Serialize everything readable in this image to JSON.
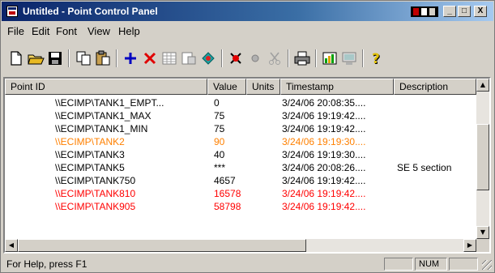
{
  "window": {
    "title": "Untitled - Point Control Panel",
    "controls": {
      "minimize": "_",
      "maximize": "□",
      "close": "X"
    }
  },
  "menu": [
    "File",
    "Edit",
    "Font",
    "View",
    "Help"
  ],
  "toolbar_icons": [
    "new-icon",
    "open-icon",
    "save-icon",
    "copy-icon",
    "paste-icon",
    "add-icon",
    "delete-icon",
    "grid-icon",
    "properties-icon",
    "refresh-icon",
    "stop-icon",
    "circle-icon",
    "cut-icon",
    "print-icon",
    "chart-icon",
    "monitor-icon",
    "help-icon"
  ],
  "table": {
    "headers": [
      "Point ID",
      "Value",
      "Units",
      "Timestamp",
      "Description"
    ],
    "rows": [
      {
        "id": "\\\\ECIMP\\TANK1_EMPT...",
        "value": "0",
        "units": "",
        "timestamp": "3/24/06  20:08:35....",
        "description": "",
        "color": "#000000"
      },
      {
        "id": "\\\\ECIMP\\TANK1_MAX",
        "value": "75",
        "units": "",
        "timestamp": "3/24/06  19:19:42....",
        "description": "",
        "color": "#000000"
      },
      {
        "id": "\\\\ECIMP\\TANK1_MIN",
        "value": "75",
        "units": "",
        "timestamp": "3/24/06  19:19:42....",
        "description": "",
        "color": "#000000"
      },
      {
        "id": "\\\\ECIMP\\TANK2",
        "value": "90",
        "units": "",
        "timestamp": "3/24/06  19:19:30....",
        "description": "",
        "color": "#ff8000"
      },
      {
        "id": "\\\\ECIMP\\TANK3",
        "value": "40",
        "units": "",
        "timestamp": "3/24/06  19:19:30....",
        "description": "",
        "color": "#000000"
      },
      {
        "id": "\\\\ECIMP\\TANK5",
        "value": "***",
        "units": "",
        "timestamp": "3/24/06  20:08:26....",
        "description": "SE 5 section",
        "color": "#000000"
      },
      {
        "id": "\\\\ECIMP\\TANK750",
        "value": "4657",
        "units": "",
        "timestamp": "3/24/06  19:19:42....",
        "description": "",
        "color": "#000000"
      },
      {
        "id": "\\\\ECIMP\\TANK810",
        "value": "16578",
        "units": "",
        "timestamp": "3/24/06  19:19:42....",
        "description": "",
        "color": "#ff0000"
      },
      {
        "id": "\\\\ECIMP\\TANK905",
        "value": "58798",
        "units": "",
        "timestamp": "3/24/06  19:19:42....",
        "description": "",
        "color": "#ff0000"
      }
    ]
  },
  "status": {
    "help": "For Help, press F1",
    "num": "NUM"
  }
}
